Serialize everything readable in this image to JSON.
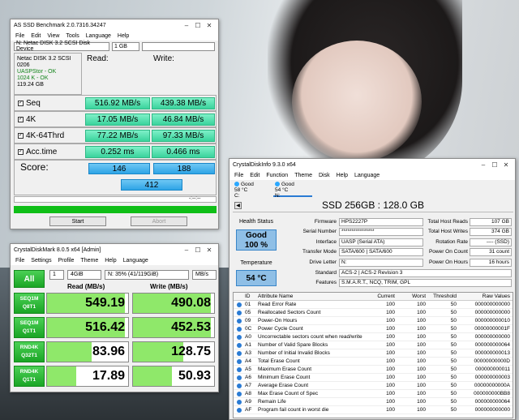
{
  "asssd": {
    "title": "AS SSD Benchmark 2.0.7316.34247",
    "menu": [
      "File",
      "Edit",
      "View",
      "Tools",
      "Language",
      "Help"
    ],
    "drive_select": "N: Netac DISK 3.2 SCSI Disk Device",
    "size_select": "1 GB",
    "info": [
      "Netac DISK 3.2 SCSI",
      "0206",
      "UASPStor - OK",
      "1024 K - OK",
      "119.24 GB"
    ],
    "read_header": "Read:",
    "write_header": "Write:",
    "tests": [
      {
        "label": "Seq",
        "read": "516.92 MB/s",
        "write": "439.38 MB/s"
      },
      {
        "label": "4K",
        "read": "17.05 MB/s",
        "write": "46.84 MB/s"
      },
      {
        "label": "4K-64Thrd",
        "read": "77.22 MB/s",
        "write": "97.33 MB/s"
      },
      {
        "label": "Acc.time",
        "read": "0.252 ms",
        "write": "0.466 ms"
      }
    ],
    "score_label": "Score:",
    "score_read": "146",
    "score_write": "188",
    "score_total": "412",
    "time_display": "-:--:--",
    "start_label": "Start",
    "abort_label": "Abort"
  },
  "cdm": {
    "title": "CrystalDiskMark 8.0.5 x64 [Admin]",
    "menu": [
      "File",
      "Settings",
      "Profile",
      "Theme",
      "Help",
      "Language"
    ],
    "all_label": "All",
    "count": "1",
    "size": "4GiB",
    "drive": "N: 35% (41/119GiB)",
    "unit": "MB/s",
    "read_header": "Read (MB/s)",
    "write_header": "Write (MB/s)",
    "rows": [
      {
        "l1": "SEQ1M",
        "l2": "Q8T1",
        "read": "549.19",
        "write": "490.08",
        "read_fill": 0.96,
        "write_fill": 0.96
      },
      {
        "l1": "SEQ1M",
        "l2": "Q1T1",
        "read": "516.42",
        "write": "452.53",
        "read_fill": 0.96,
        "write_fill": 0.96
      },
      {
        "l1": "RND4K",
        "l2": "Q32T1",
        "read": "83.96",
        "write": "128.75",
        "read_fill": 0.55,
        "write_fill": 0.62
      },
      {
        "l1": "RND4K",
        "l2": "Q1T1",
        "read": "17.89",
        "write": "50.93",
        "read_fill": 0.36,
        "write_fill": 0.48
      }
    ]
  },
  "cdi": {
    "title": "CrystalDiskInfo 9.3.0 x64",
    "menu": [
      "File",
      "Edit",
      "Function",
      "Theme",
      "Disk",
      "Help",
      "Language"
    ],
    "drives": [
      {
        "status": "Good",
        "temp": "58 °C",
        "letter": "C:"
      },
      {
        "status": "Good",
        "temp": "54 °C",
        "letter": "N:"
      }
    ],
    "model": "SSD 256GB : 128.0 GB",
    "health_label": "Health Status",
    "health_status": "Good",
    "health_percent": "100 %",
    "temp_label": "Temperature",
    "temp_value": "54 °C",
    "fields_left": [
      {
        "k": "Firmware",
        "v": "HPS2227P"
      },
      {
        "k": "Serial Number",
        "v": "****************"
      },
      {
        "k": "Interface",
        "v": "UASP (Serial ATA)"
      },
      {
        "k": "Transfer Mode",
        "v": "SATA/600 | SATA/600"
      },
      {
        "k": "Drive Letter",
        "v": "N:"
      }
    ],
    "fields_right": [
      {
        "k": "Total Host Reads",
        "v": "107 GB"
      },
      {
        "k": "Total Host Writes",
        "v": "374 GB"
      },
      {
        "k": "Rotation Rate",
        "v": "---- (SSD)"
      },
      {
        "k": "Power On Count",
        "v": "31 count"
      },
      {
        "k": "Power On Hours",
        "v": "16 hours"
      }
    ],
    "standard_label": "Standard",
    "standard_value": "ACS-2 | ACS-2 Revision 3",
    "features_label": "Features",
    "features_value": "S.M.A.R.T., NCQ, TRIM, GPL",
    "smart_headers": [
      "ID",
      "Attribute Name",
      "Current",
      "Worst",
      "Threshold",
      "Raw Values"
    ],
    "smart_rows": [
      [
        "01",
        "Read Error Rate",
        "100",
        "100",
        "50",
        "000000000000"
      ],
      [
        "05",
        "Reallocated Sectors Count",
        "100",
        "100",
        "50",
        "000000000000"
      ],
      [
        "09",
        "Power-On Hours",
        "100",
        "100",
        "50",
        "000000000010"
      ],
      [
        "0C",
        "Power Cycle Count",
        "100",
        "100",
        "50",
        "00000000001F"
      ],
      [
        "A0",
        "Uncorrectable sectors count when read/write",
        "100",
        "100",
        "50",
        "000000000000"
      ],
      [
        "A1",
        "Number of Valid Spare Blocks",
        "100",
        "100",
        "50",
        "000000000064"
      ],
      [
        "A3",
        "Number of Initial Invalid Blocks",
        "100",
        "100",
        "50",
        "000000000013"
      ],
      [
        "A4",
        "Total Erase Count",
        "100",
        "100",
        "50",
        "00000000000D"
      ],
      [
        "A5",
        "Maximum Erase Count",
        "100",
        "100",
        "50",
        "000000000011"
      ],
      [
        "A6",
        "Minimum Erase Count",
        "100",
        "100",
        "50",
        "000000000003"
      ],
      [
        "A7",
        "Average Erase Count",
        "100",
        "100",
        "50",
        "00000000000A"
      ],
      [
        "A8",
        "Max Erase Count of Spec",
        "100",
        "100",
        "50",
        "000000000BB8"
      ],
      [
        "A9",
        "Remain Life",
        "100",
        "100",
        "50",
        "000000000064"
      ],
      [
        "AF",
        "Program fail count in worst die",
        "100",
        "100",
        "50",
        "000000000000"
      ]
    ]
  }
}
